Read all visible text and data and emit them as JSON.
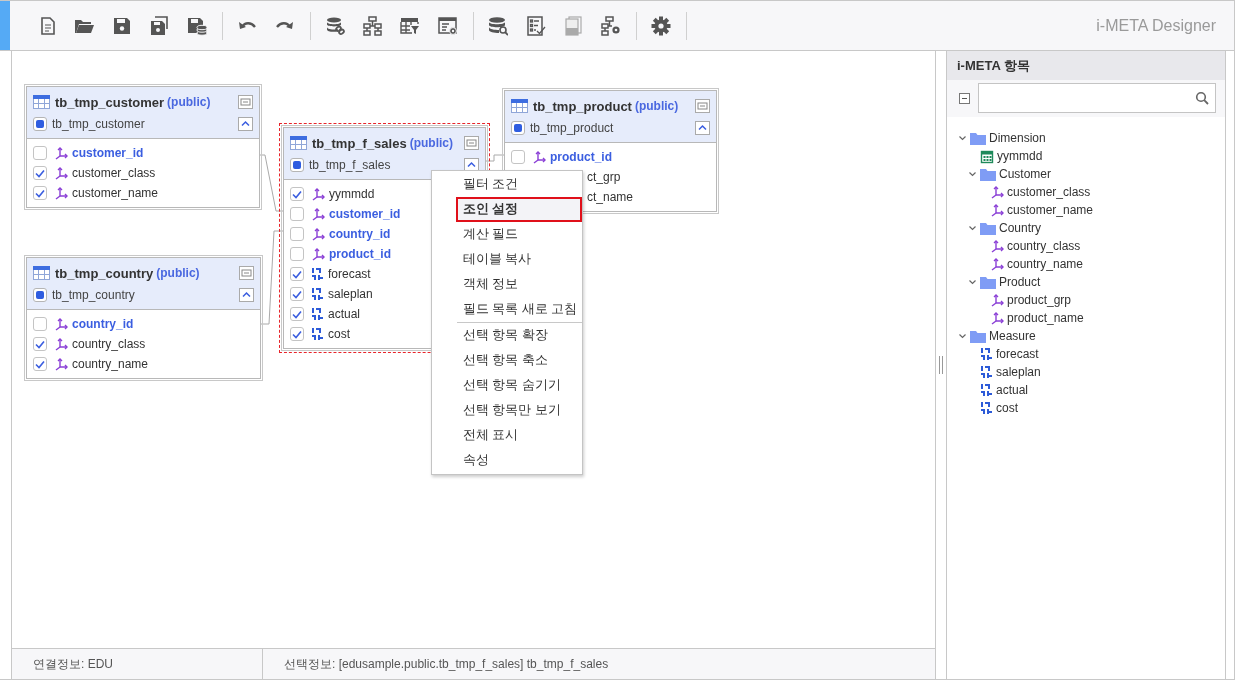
{
  "toolbar": {
    "groups": [
      [
        {
          "kind": "new",
          "disabled": false
        },
        {
          "kind": "open",
          "disabled": false
        },
        {
          "kind": "save",
          "disabled": false
        },
        {
          "kind": "save_all",
          "disabled": false
        },
        {
          "kind": "save_db",
          "disabled": false
        }
      ],
      [
        {
          "kind": "undo",
          "disabled": false
        },
        {
          "kind": "redo",
          "disabled": false
        }
      ],
      [
        {
          "kind": "db_link",
          "disabled": false
        },
        {
          "kind": "hierarchy",
          "disabled": false
        },
        {
          "kind": "table_filter",
          "disabled": false
        },
        {
          "kind": "window_gear",
          "disabled": false
        }
      ],
      [
        {
          "kind": "db_search",
          "disabled": false
        },
        {
          "kind": "checklist",
          "disabled": false
        },
        {
          "kind": "documents",
          "disabled": true
        },
        {
          "kind": "hierarchy_gear",
          "disabled": false
        }
      ],
      [
        {
          "kind": "settings",
          "disabled": false
        }
      ]
    ],
    "title": "i-META Designer"
  },
  "tables": [
    {
      "name": "tb_tmp_customer",
      "schema": "(public)",
      "alias": "tb_tmp_customer",
      "selected": false,
      "fields": [
        {
          "name": "customer_id",
          "kind": "dim",
          "key": true,
          "checked": false
        },
        {
          "name": "customer_class",
          "kind": "dim",
          "key": false,
          "checked": true
        },
        {
          "name": "customer_name",
          "kind": "dim",
          "key": false,
          "checked": true
        }
      ]
    },
    {
      "name": "tb_tmp_f_sales",
      "schema": "(public)",
      "alias": "tb_tmp_f_sales",
      "selected": true,
      "fields": [
        {
          "name": "yymmdd",
          "kind": "dim",
          "key": false,
          "checked": true
        },
        {
          "name": "customer_id",
          "kind": "dim",
          "key": true,
          "checked": false
        },
        {
          "name": "country_id",
          "kind": "dim",
          "key": true,
          "checked": false
        },
        {
          "name": "product_id",
          "kind": "dim",
          "key": true,
          "checked": false
        },
        {
          "name": "forecast",
          "kind": "measure",
          "key": false,
          "checked": true
        },
        {
          "name": "saleplan",
          "kind": "measure",
          "key": false,
          "checked": true
        },
        {
          "name": "actual",
          "kind": "measure",
          "key": false,
          "checked": true
        },
        {
          "name": "cost",
          "kind": "measure",
          "key": false,
          "checked": true
        }
      ]
    },
    {
      "name": "tb_tmp_country",
      "schema": "(public)",
      "alias": "tb_tmp_country",
      "selected": false,
      "fields": [
        {
          "name": "country_id",
          "kind": "dim",
          "key": true,
          "checked": false
        },
        {
          "name": "country_class",
          "kind": "dim",
          "key": false,
          "checked": true
        },
        {
          "name": "country_name",
          "kind": "dim",
          "key": false,
          "checked": true
        }
      ]
    },
    {
      "name": "tb_tmp_product",
      "schema": "(public)",
      "alias": "tb_tmp_product",
      "selected": false,
      "fields": [
        {
          "name": "product_id",
          "kind": "dim",
          "key": true,
          "checked": false
        },
        {
          "name": "ct_grp",
          "kind": "clipped"
        },
        {
          "name": "ct_name",
          "kind": "clipped"
        }
      ]
    }
  ],
  "context_menu": {
    "groups": [
      [
        {
          "label": "필터 조건",
          "selected": false
        },
        {
          "label": "조인 설정",
          "selected": true
        },
        {
          "label": "계산 필드",
          "selected": false
        },
        {
          "label": "테이블 복사",
          "selected": false
        },
        {
          "label": "객체 정보",
          "selected": false
        },
        {
          "label": "필드 목록 새로 고침",
          "selected": false
        }
      ],
      [
        {
          "label": "선택 항목 확장",
          "selected": false
        },
        {
          "label": "선택 항목 축소",
          "selected": false
        },
        {
          "label": "선택 항목 숨기기",
          "selected": false
        },
        {
          "label": "선택 항목만 보기",
          "selected": false
        },
        {
          "label": "전체 표시",
          "selected": false
        },
        {
          "label": "속성",
          "selected": false
        }
      ]
    ]
  },
  "status_bar": {
    "connection": "연결정보: EDU",
    "selection": "선택정보: [edusample.public.tb_tmp_f_sales] tb_tmp_f_sales"
  },
  "panel": {
    "title": "i-META 항목",
    "tree": [
      {
        "label": "Dimension",
        "kind": "folder",
        "expanded": true,
        "children": [
          {
            "label": "yymmdd",
            "kind": "date"
          },
          {
            "label": "Customer",
            "kind": "folder",
            "expanded": true,
            "children": [
              {
                "label": "customer_class",
                "kind": "dim"
              },
              {
                "label": "customer_name",
                "kind": "dim"
              }
            ]
          },
          {
            "label": "Country",
            "kind": "folder",
            "expanded": true,
            "children": [
              {
                "label": "country_class",
                "kind": "dim"
              },
              {
                "label": "country_name",
                "kind": "dim"
              }
            ]
          },
          {
            "label": "Product",
            "kind": "folder",
            "expanded": true,
            "children": [
              {
                "label": "product_grp",
                "kind": "dim"
              },
              {
                "label": "product_name",
                "kind": "dim"
              }
            ]
          }
        ]
      },
      {
        "label": "Measure",
        "kind": "folder",
        "expanded": true,
        "children": [
          {
            "label": "forecast",
            "kind": "measure"
          },
          {
            "label": "saleplan",
            "kind": "measure"
          },
          {
            "label": "actual",
            "kind": "measure"
          },
          {
            "label": "cost",
            "kind": "measure"
          }
        ]
      }
    ]
  }
}
